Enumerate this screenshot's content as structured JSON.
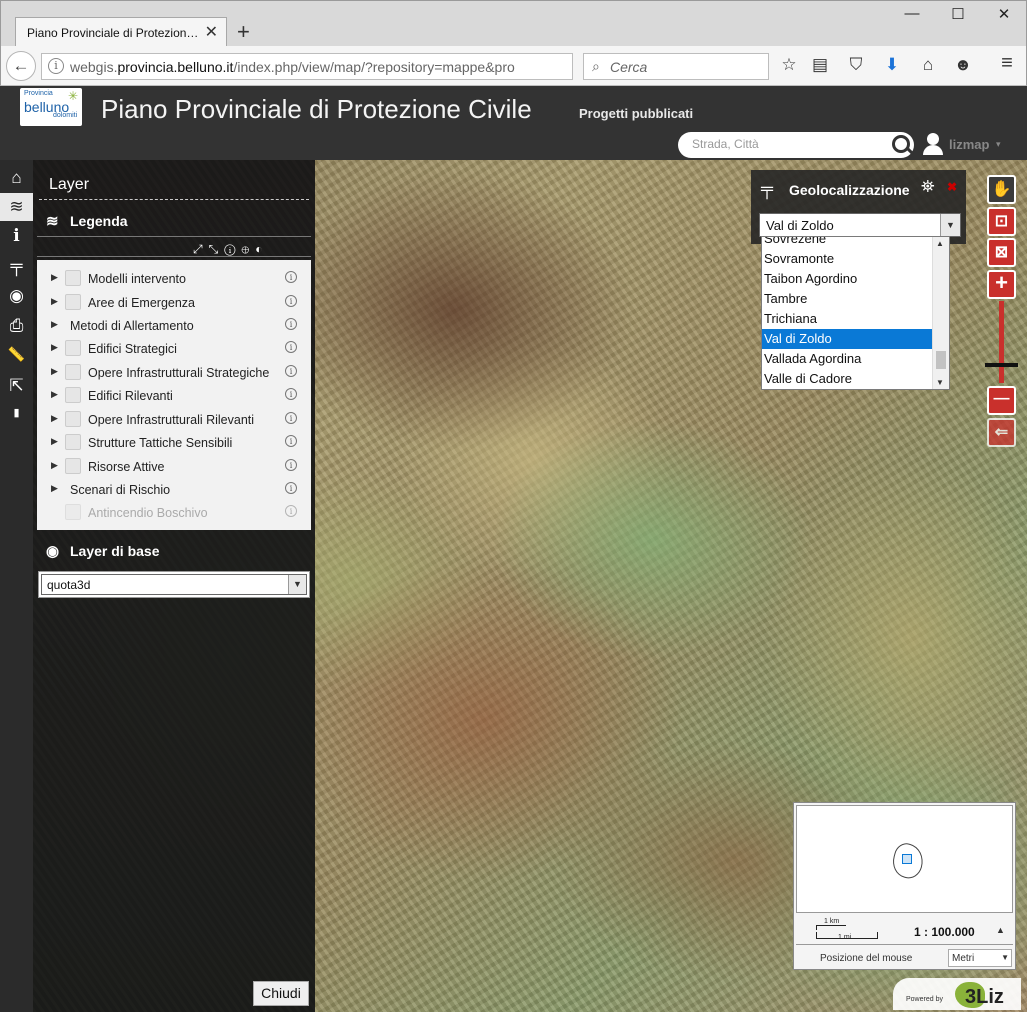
{
  "browser": {
    "tab_title": "Piano Provinciale di Protezion…",
    "tab_close": "✕",
    "new_tab": "+",
    "window_controls": {
      "minimize": "—",
      "maximize": "☐",
      "close": "✕"
    },
    "back": "←",
    "info": "i",
    "url_prefix": "webgis.",
    "url_domain": "provincia.belluno.it",
    "url_path": "/index.php/view/map/?repository=mappe&pro",
    "reload": "↻",
    "search_icon": "⌕",
    "search_placeholder": "Cerca",
    "toolbar_icons": [
      "star-icon",
      "reading-list-icon",
      "pocket-icon",
      "download-icon",
      "home-icon",
      "chat-icon",
      "hamburger-menu-icon"
    ],
    "toolbar_glyphs": {
      "star": "☆",
      "reading": "▤",
      "pocket": "⛉",
      "download": "⬇",
      "home": "⌂",
      "chat": "☻",
      "menu": "≡"
    }
  },
  "header": {
    "logo_small": "Provincia",
    "logo_main": "belluno",
    "logo_sub": "dolomiti",
    "logo_star": "✳",
    "title": "Piano Provinciale di Protezione Civile",
    "subtitle": "Progetti pubblicati",
    "search_placeholder": "Strada, Città",
    "user_name": "lizmap",
    "user_caret": "▾"
  },
  "menu": {
    "items": [
      {
        "name": "home",
        "glyph": "⌂"
      },
      {
        "name": "layers",
        "glyph": "≋"
      },
      {
        "name": "info",
        "glyph": "i"
      },
      {
        "name": "geolocation",
        "glyph": "╤"
      },
      {
        "name": "locate",
        "glyph": "◉"
      },
      {
        "name": "print",
        "glyph": "⎙"
      },
      {
        "name": "measure",
        "glyph": "📏"
      },
      {
        "name": "share",
        "glyph": "⇱"
      },
      {
        "name": "comment",
        "glyph": "▮"
      }
    ]
  },
  "layer_panel": {
    "title": "Layer",
    "legend_icon": "≋",
    "legend_title": "Legenda",
    "legend_tools": "⤢⤡ⓘ⊕◐",
    "layers": [
      {
        "label": "Modelli intervento",
        "checkbox": true,
        "disabled": false
      },
      {
        "label": "Aree di Emergenza",
        "checkbox": true,
        "disabled": false
      },
      {
        "label": "Metodi di Allertamento",
        "checkbox": false,
        "disabled": false
      },
      {
        "label": "Edifici Strategici",
        "checkbox": true,
        "disabled": false
      },
      {
        "label": "Opere Infrastrutturali Strategiche",
        "checkbox": true,
        "disabled": false
      },
      {
        "label": "Edifici Rilevanti",
        "checkbox": true,
        "disabled": false
      },
      {
        "label": "Opere Infrastrutturali Rilevanti",
        "checkbox": true,
        "disabled": false
      },
      {
        "label": "Strutture Tattiche Sensibili",
        "checkbox": true,
        "disabled": false
      },
      {
        "label": "Risorse Attive",
        "checkbox": true,
        "disabled": false
      },
      {
        "label": "Scenari di Rischio",
        "checkbox": false,
        "disabled": false
      },
      {
        "label": "Antincendio Boschivo",
        "checkbox": true,
        "disabled": true
      }
    ],
    "tree_arrow": "▶",
    "info_glyph": "i",
    "base_icon": "◉",
    "base_title": "Layer di base",
    "base_value": "quota3d",
    "select_arrow": "▼",
    "close_label": "Chiudi"
  },
  "geolocation": {
    "icon": "╤",
    "title": "Geolocalizzazione",
    "tool_icon": "⛯",
    "close": "✖",
    "selected": "Val di Zoldo",
    "arrow": "▼",
    "options": [
      "Sovrezene",
      "Sovramonte",
      "Taibon Agordino",
      "Tambre",
      "Trichiana",
      "Val di Zoldo",
      "Vallada Agordina",
      "Valle di Cadore"
    ],
    "selected_index": 5,
    "scroll_up": "▲",
    "scroll_down": "▼"
  },
  "nav_tools": {
    "pan": "✋",
    "zoom_box": "⊡",
    "zoom_extent": "⊠",
    "zoom_in": "+",
    "zoom_out": "—",
    "previous": "⇐"
  },
  "overview": {
    "scale_km": "1 km",
    "scale_mi": "1 mi",
    "ratio": "1 : 100.000",
    "toggle": "▲",
    "mouse_position_label": "Posizione del mouse",
    "unit": "Metri",
    "unit_arrow": "▼"
  },
  "footer": {
    "powered_by": "Powered by",
    "brand": "3Liz"
  }
}
